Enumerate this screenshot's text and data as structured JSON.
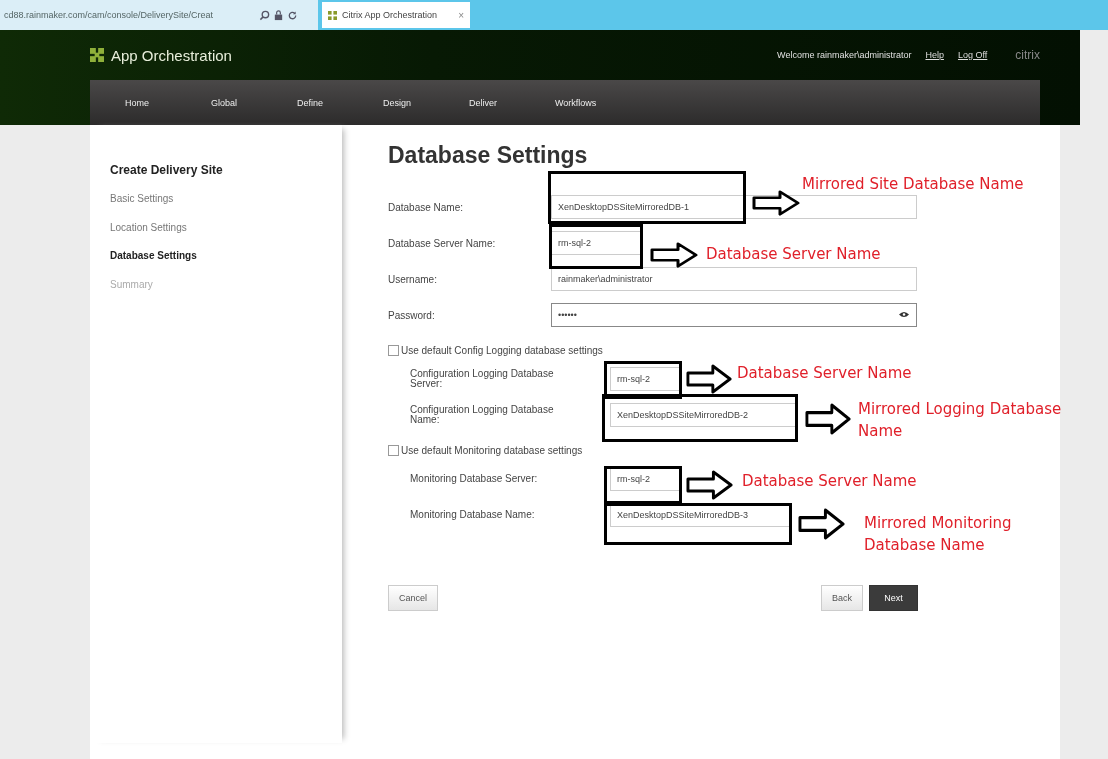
{
  "browser": {
    "address": "cd88.rainmaker.com/cam/console/DeliverySite/Creat",
    "tab_title": "Citrix App Orchestration",
    "tab_close": "×"
  },
  "header": {
    "app_title": "App Orchestration",
    "welcome": "Welcome rainmaker\\administrator",
    "links": [
      "Help",
      "Log Off"
    ],
    "brand": "citrix"
  },
  "nav": [
    {
      "label": "Home"
    },
    {
      "label": "Global"
    },
    {
      "label": "Define"
    },
    {
      "label": "Design"
    },
    {
      "label": "Deliver"
    },
    {
      "label": "Workflows"
    }
  ],
  "sidebar": {
    "title": "Create Delivery Site",
    "steps": [
      {
        "label": "Basic Settings",
        "selected": false,
        "disabled": false
      },
      {
        "label": "Location Settings",
        "selected": false,
        "disabled": false
      },
      {
        "label": "Database Settings",
        "selected": true,
        "disabled": false
      },
      {
        "label": "Summary",
        "selected": false,
        "disabled": true
      }
    ]
  },
  "form": {
    "title": "Database Settings",
    "fields": [
      {
        "label": "Database Name:",
        "value": "XenDesktopDSSiteMirroredDB-1",
        "kind": "text"
      },
      {
        "label": "Database Server Name:",
        "value": "rm-sql-2",
        "kind": "text"
      },
      {
        "label": "Username:",
        "value": "rainmaker\\administrator",
        "kind": "text"
      },
      {
        "label": "Password:",
        "value": "••••••",
        "kind": "password"
      }
    ],
    "sections": [
      {
        "checkbox_label": "Use default Config Logging database settings",
        "checked": false,
        "fields": [
          {
            "label": "Configuration Logging Database Server:",
            "value": "rm-sql-2",
            "kind": "text"
          },
          {
            "label": "Configuration Logging Database Name:",
            "value": "XenDesktopDSSiteMirroredDB-2",
            "kind": "text"
          }
        ]
      },
      {
        "checkbox_label": "Use default Monitoring database settings",
        "checked": false,
        "fields": [
          {
            "label": "Monitoring Database Server:",
            "value": "rm-sql-2",
            "kind": "text"
          },
          {
            "label": "Monitoring Database Name:",
            "value": "XenDesktopDSSiteMirroredDB-3",
            "kind": "text"
          }
        ]
      }
    ],
    "buttons": [
      {
        "label": "Cancel",
        "kind": "secondary"
      },
      {
        "label": "Back",
        "kind": "secondary"
      },
      {
        "label": "Next",
        "kind": "primary"
      }
    ]
  },
  "annotations": [
    {
      "text": "Mirrored Site Database Name"
    },
    {
      "text": "Database Server Name"
    },
    {
      "text": "Database Server Name"
    },
    {
      "text": "Mirrored Logging Database Name"
    },
    {
      "text": "Database Server Name"
    },
    {
      "text": "Mirrored Monitoring Database Name"
    }
  ]
}
